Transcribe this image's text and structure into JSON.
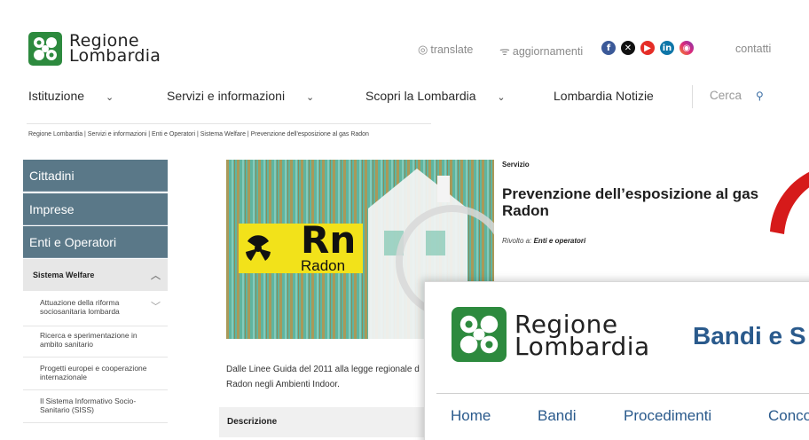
{
  "header": {
    "logo_line1": "Regione",
    "logo_line2": "Lombardia",
    "translate": "translate",
    "updates": "aggiornamenti",
    "contacts": "contatti",
    "social": [
      "facebook",
      "x",
      "youtube",
      "linkedin",
      "instagram"
    ]
  },
  "nav": {
    "items": [
      "Istituzione",
      "Servizi e informazioni",
      "Scopri la Lombardia",
      "Lombardia Notizie"
    ],
    "search": "Cerca"
  },
  "breadcrumb": "Regione Lombardia | Servizi e informazioni | Enti e Operatori | Sistema Welfare | Prevenzione dell'esposizione al gas Radon",
  "sidebar": {
    "tabs": [
      "Cittadini",
      "Imprese",
      "Enti e Operatori"
    ],
    "section": "Sistema Welfare",
    "items": [
      "Attuazione della riforma sociosanitaria lombarda",
      "Ricerca e sperimentazione in ambito sanitario",
      "Progetti europei e cooperazione internazionale",
      "Il Sistema Informativo Socio-Sanitario (SISS)"
    ]
  },
  "hero": {
    "symbol": "Rn",
    "word": "Radon"
  },
  "service": {
    "label": "Servizio",
    "title": "Prevenzione dell’esposizione al gas Radon",
    "audience_prefix": "Rivolto a:",
    "audience": "Enti e operatori"
  },
  "intro": "Dalle Linee Guida del 2011 alla legge regionale d Radon negli Ambienti Indoor.",
  "description_header": "Descrizione",
  "overlay": {
    "logo_line1": "Regione",
    "logo_line2": "Lombardia",
    "heading": "Bandi e S",
    "nav": [
      "Home",
      "Bandi",
      "Procedimenti",
      "Conco"
    ]
  },
  "colors": {
    "brand_green": "#2d8a3e",
    "sidebar_blue": "#5a7888",
    "link_blue": "#2a5a8c",
    "accent_red": "#d61a1a"
  }
}
